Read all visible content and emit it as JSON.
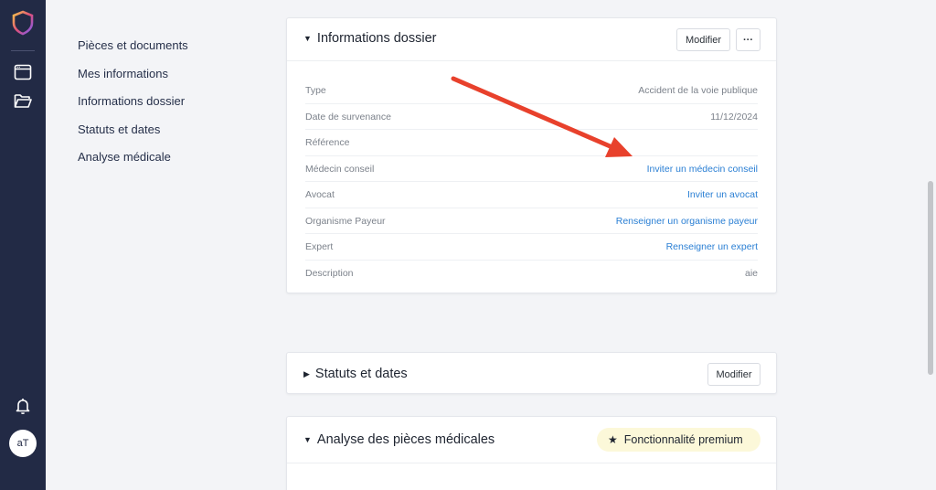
{
  "sidebar": {
    "icons": [
      "shield-logo",
      "window-icon",
      "folder-icon",
      "bell-icon"
    ],
    "avatar_initials": "aT"
  },
  "subnav": {
    "items": [
      {
        "label": "Pièces et documents"
      },
      {
        "label": "Mes informations"
      },
      {
        "label": "Informations dossier"
      },
      {
        "label": "Statuts et dates"
      },
      {
        "label": "Analyse médicale"
      }
    ]
  },
  "info_card": {
    "title": "Informations dossier",
    "modify_label": "Modifier",
    "more_label": "···",
    "rows": [
      {
        "label": "Type",
        "value": "Accident de la voie publique",
        "is_link": false
      },
      {
        "label": "Date de survenance",
        "value": "11/12/2024",
        "is_link": false
      },
      {
        "label": "Référence",
        "value": "",
        "is_link": false
      },
      {
        "label": "Médecin conseil",
        "value": "Inviter un médecin conseil",
        "is_link": true
      },
      {
        "label": "Avocat",
        "value": "Inviter un avocat",
        "is_link": true
      },
      {
        "label": "Organisme Payeur",
        "value": "Renseigner un organisme payeur",
        "is_link": true
      },
      {
        "label": "Expert",
        "value": "Renseigner un expert",
        "is_link": true
      },
      {
        "label": "Description",
        "value": "aie",
        "is_link": false
      }
    ]
  },
  "status_card": {
    "title": "Statuts et dates",
    "modify_label": "Modifier"
  },
  "analysis_card": {
    "title": "Analyse des pièces médicales",
    "premium_label": "Fonctionnalité premium"
  },
  "colors": {
    "sidebar_bg": "#222a45",
    "link": "#2a7fd4",
    "annotation_arrow": "#e8412c",
    "premium_bg": "#fcf8d9"
  }
}
